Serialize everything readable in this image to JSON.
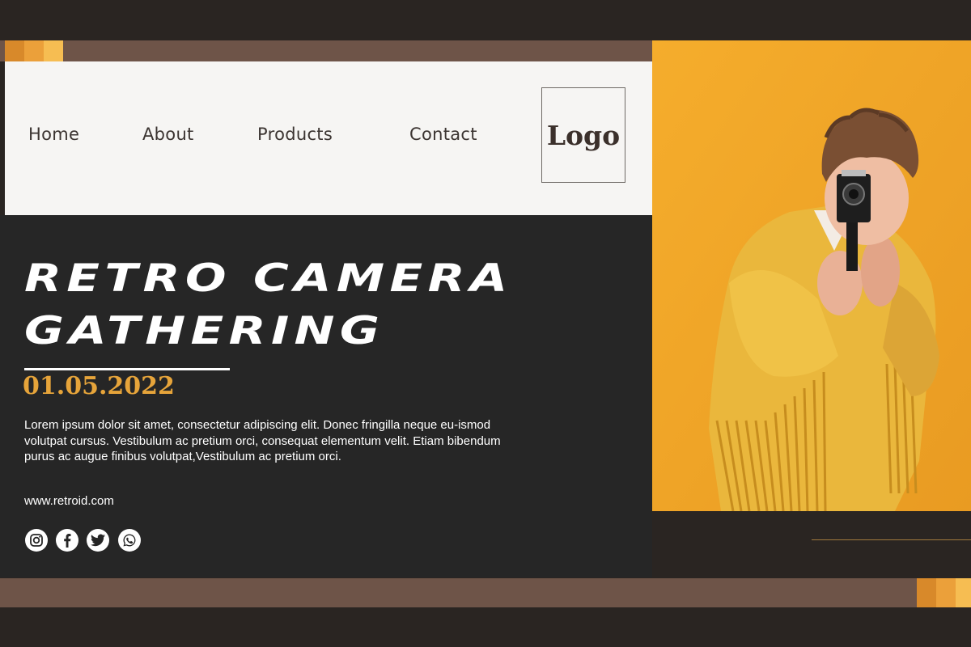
{
  "nav": {
    "items": [
      {
        "label": "Home"
      },
      {
        "label": "About"
      },
      {
        "label": "Products"
      },
      {
        "label": "Contact"
      }
    ],
    "logo": "Logo"
  },
  "hero": {
    "headline_line1": "RETRO CAMERA",
    "headline_line2": "GATHERING",
    "date": "01.05.2022",
    "body": "Lorem ipsum dolor sit amet, consectetur adipiscing elit. Donec fringilla neque eu-ismod volutpat cursus. Vestibulum ac pretium orci, consequat elementum velit. Etiam bibendum purus ac augue finibus volutpat,Vestibulum ac pretium orci.",
    "website": "www.retroid.com"
  },
  "social": [
    {
      "icon": "instagram-icon"
    },
    {
      "icon": "facebook-icon"
    },
    {
      "icon": "twitter-icon"
    },
    {
      "icon": "whatsapp-icon"
    }
  ],
  "colors": {
    "background": "#2a2522",
    "panel_dark": "#262626",
    "bar_brown": "#6e5448",
    "accent_orange": "#f0a72a",
    "date_gold": "#e6a43a",
    "nav_panel": "#f6f5f3"
  }
}
